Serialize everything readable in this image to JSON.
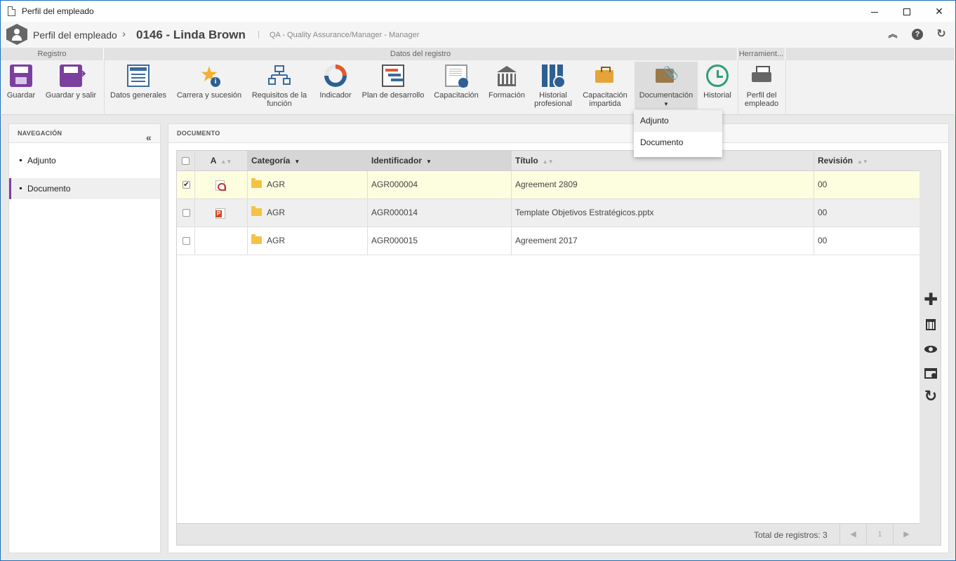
{
  "window": {
    "title": "Perfil del empleado"
  },
  "header": {
    "app": "Perfil del empleado",
    "record": "0146 - Linda Brown",
    "separator": "|",
    "subtitle": "QA - Quality Assurance/Manager - Manager"
  },
  "ribbon": {
    "groups": {
      "registro": "Registro",
      "datos": "Datos del registro",
      "herramientas": "Herramient..."
    },
    "buttons": {
      "guardar": "Guardar",
      "guardar_salir": "Guardar y salir",
      "datos_generales": "Datos generales",
      "carrera": "Carrera y sucesión",
      "requisitos": "Requisitos de la función",
      "indicador": "Indicador",
      "plan": "Plan de desarrollo",
      "capacitacion": "Capacitación",
      "formacion": "Formación",
      "historial_prof": "Historial profesional",
      "capacitacion_imp": "Capacitación impartida",
      "documentacion": "Documentación",
      "historial": "Historial",
      "perfil": "Perfil del empleado"
    }
  },
  "dropdown": {
    "items": [
      "Adjunto",
      "Documento"
    ]
  },
  "nav": {
    "title": "NAVEGACIÓN",
    "items": [
      "Adjunto",
      "Documento"
    ],
    "active_index": 1
  },
  "document": {
    "title": "DOCUMENTO",
    "columns": {
      "a": "A",
      "categoria": "Categoría",
      "identificador": "Identificador",
      "titulo": "Título",
      "revision": "Revisión"
    },
    "rows": [
      {
        "checked": true,
        "filetype": "pdf",
        "categoria": "AGR",
        "identificador": "AGR000004",
        "titulo": "Agreement 2809",
        "revision": "00"
      },
      {
        "checked": false,
        "filetype": "pptx",
        "categoria": "AGR",
        "identificador": "AGR000014",
        "titulo": "Template Objetivos Estratégicos.pptx",
        "revision": "00"
      },
      {
        "checked": false,
        "filetype": "",
        "categoria": "AGR",
        "identificador": "AGR000015",
        "titulo": "Agreement 2017",
        "revision": "00"
      }
    ],
    "footer": {
      "total": "Total de registros: 3",
      "page": "1"
    }
  },
  "icons": {
    "add": "plus-icon",
    "delete": "trash-icon",
    "view": "eye-icon",
    "preview": "preview-window-icon",
    "refresh": "refresh-icon"
  },
  "colors": {
    "accent": "#7b3fa0",
    "window_border": "#1e6fb8",
    "selected_row": "#fdfde0"
  }
}
